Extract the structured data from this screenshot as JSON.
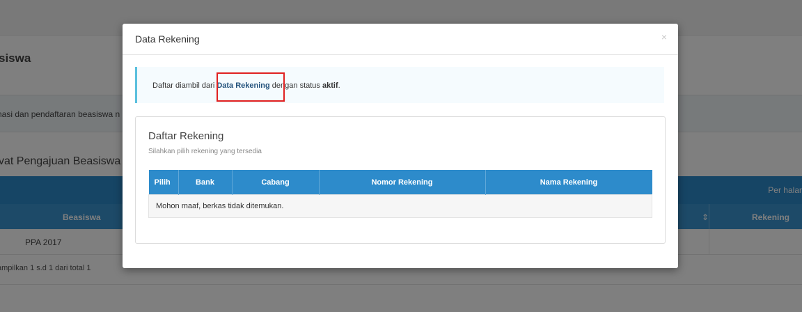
{
  "background": {
    "page_title": "siswa",
    "info_text": "nasi dan pendaftaran beasiswa n",
    "section_title": "vat Pengajuan Beasiswa",
    "per_page_label": "Per halar",
    "table": {
      "col_beasiswa": "Beasiswa",
      "col_rekening": "Rekening",
      "sort_icon": "⇕",
      "rows": [
        "PPA 2017"
      ]
    },
    "footer_text": "ampilkan 1 s.d 1 dari total 1"
  },
  "modal": {
    "title": "Data Rekening",
    "close": "×",
    "callout": {
      "prefix": "Daftar diambil dari ",
      "link": "Data Rekening",
      "middle": " dengan status ",
      "status": "aktif",
      "suffix": "."
    },
    "panel": {
      "title": "Daftar Rekening",
      "subtitle": "Silahkan pilih rekening yang tersedia",
      "columns": [
        "Pilih",
        "Bank",
        "Cabang",
        "Nomor Rekening",
        "Nama Rekening"
      ],
      "empty_message": "Mohon maaf, berkas tidak ditemukan."
    }
  },
  "colors": {
    "header_blue": "#2d8bcb",
    "callout_border": "#5bc0de",
    "highlight_red": "#e02020"
  }
}
